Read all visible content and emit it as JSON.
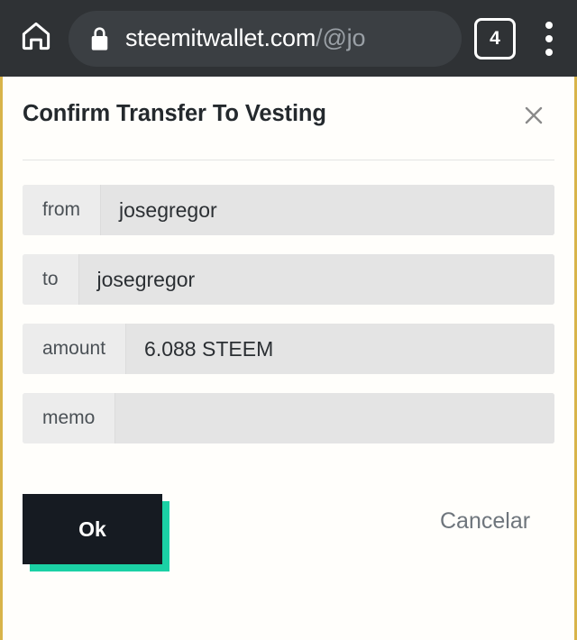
{
  "browser": {
    "home_icon": "home-icon",
    "lock_icon": "lock-icon",
    "url_host": "steemitwallet.com",
    "url_path": "/@jo",
    "tab_count": "4",
    "menu_icon": "overflow-menu-icon"
  },
  "dialog": {
    "title": "Confirm Transfer To Vesting",
    "close_icon": "close-icon",
    "fields": [
      {
        "label": "from",
        "value": "josegregor"
      },
      {
        "label": "to",
        "value": "josegregor"
      },
      {
        "label": "amount",
        "value": "6.088 STEEM"
      },
      {
        "label": "memo",
        "value": ""
      }
    ],
    "confirm_label": "Ok",
    "cancel_label": "Cancelar"
  },
  "colors": {
    "chrome_bg": "#2f3235",
    "url_pill_bg": "#3b3f43",
    "page_border": "#d8b44a",
    "accent_teal": "#1bd1a5",
    "button_dark": "#161b22",
    "field_label_bg": "#ececec",
    "field_value_bg": "#e4e4e4",
    "cancel_text": "#6e757c"
  }
}
